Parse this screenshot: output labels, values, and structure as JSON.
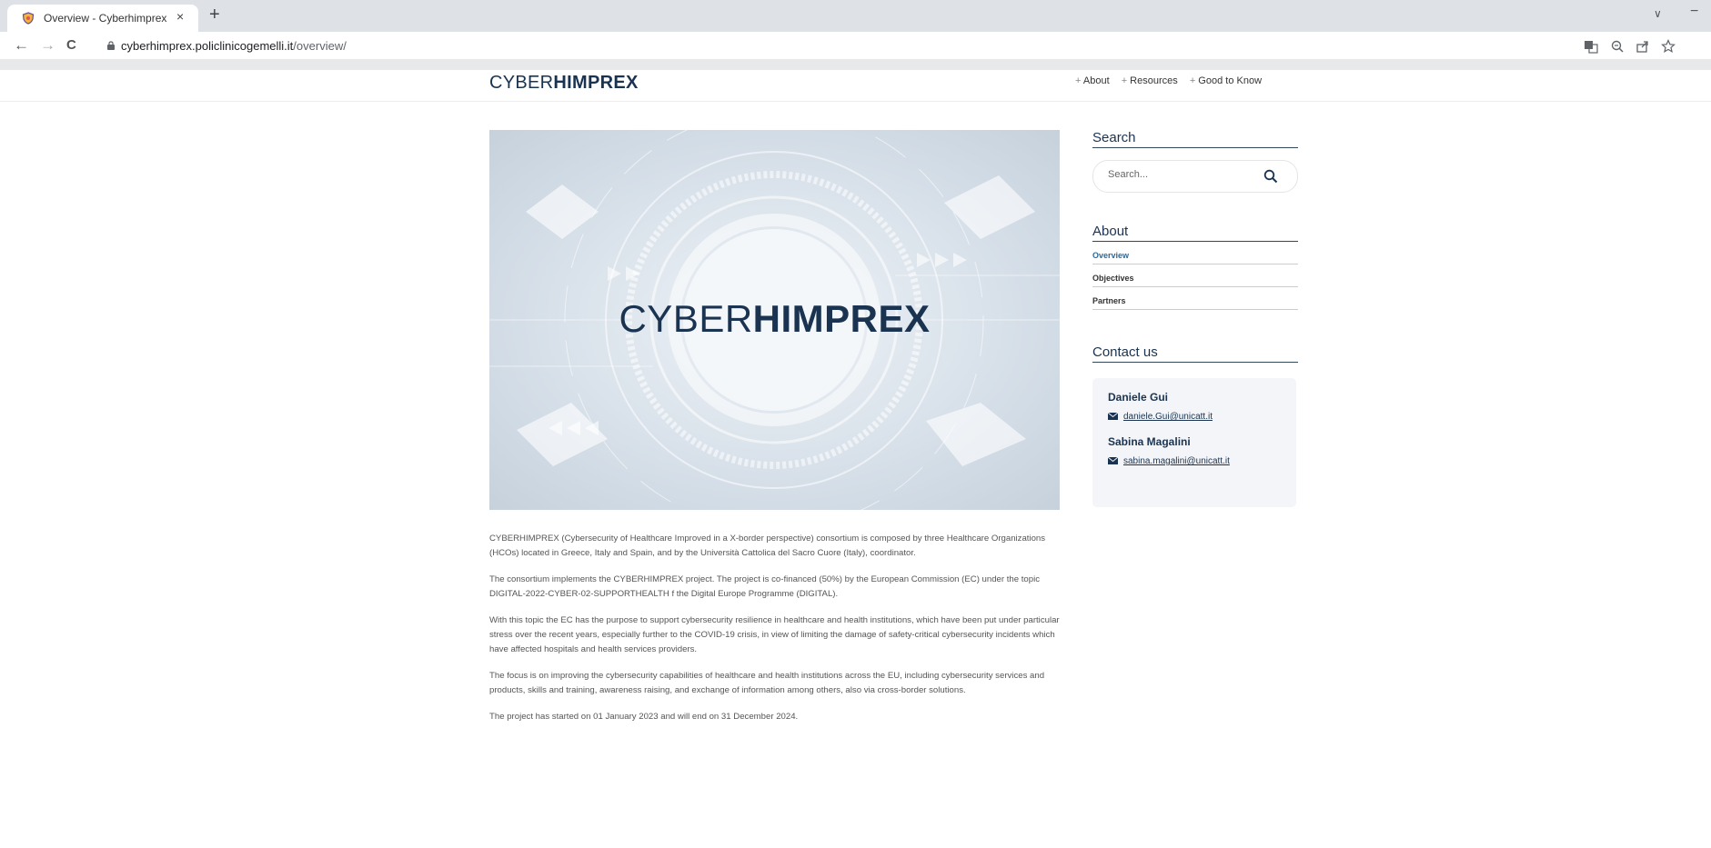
{
  "browser": {
    "tab_title": "Overview - Cyberhimprex",
    "tab_close": "×",
    "new_tab": "+",
    "url_host": "cyberhimprex.policlinicogemelli.it",
    "url_path": "/overview/",
    "back_icon": "←",
    "forward_icon": "→",
    "reload_icon": "C",
    "tab_search_icon": "∨",
    "minimize_icon": "−"
  },
  "site": {
    "logo_light": "CYBER",
    "logo_bold": "HIMPREX",
    "nav": [
      {
        "prefix": "+ ",
        "label": "About"
      },
      {
        "prefix": "+ ",
        "label": "Resources"
      },
      {
        "prefix": "+ ",
        "label": "Good to Know"
      }
    ]
  },
  "hero": {
    "title_light": "CYBER",
    "title_bold": "HIMPREX"
  },
  "article": {
    "paragraphs": [
      "CYBERHIMPREX (Cybersecurity of Healthcare Improved in a X-border perspective) consortium is composed by three Healthcare Organizations (HCOs) located in Greece, Italy and Spain, and by the Università Cattolica del Sacro Cuore (Italy), coordinator.",
      "The consortium implements the CYBERHIMPREX project. The project is co-financed (50%) by the European Commission (EC) under the topic DIGITAL-2022-CYBER-02-SUPPORTHEALTH f the Digital Europe Programme (DIGITAL).",
      "With this topic the EC has the purpose to support cybersecurity resilience in healthcare and health institutions, which have been put under particular stress over the recent years, especially further to the COVID-19 crisis, in view of limiting the damage of safety-critical cybersecurity incidents which have affected hospitals and health services providers.",
      "The focus is on improving the cybersecurity capabilities of healthcare and health institutions across the EU, including cybersecurity services and products, skills and training, awareness raising, and exchange of information among others, also via cross-border solutions.",
      "The project has started on 01 January 2023 and will end on 31 December 2024."
    ]
  },
  "sidebar": {
    "search_heading": "Search",
    "search_placeholder": "Search...",
    "about_heading": "About",
    "about_links": [
      {
        "label": "Overview",
        "active": true
      },
      {
        "label": "Objectives",
        "active": false
      },
      {
        "label": "Partners",
        "active": false
      }
    ],
    "contact_heading": "Contact us",
    "contacts": [
      {
        "name": "Daniele Gui",
        "email": "daniele.Gui@unicatt.it"
      },
      {
        "name": "Sabina Magalini",
        "email": "sabina.magalini@unicatt.it"
      }
    ]
  },
  "colors": {
    "brand": "#1a3350",
    "active_link": "#2b6a9a",
    "chrome_tabbar": "#dee1e6"
  },
  "icons": [
    "shield-favicon-icon",
    "lock-icon",
    "translate-icon",
    "zoom-icon",
    "share-icon",
    "star-icon",
    "search-icon",
    "mail-icon"
  ]
}
